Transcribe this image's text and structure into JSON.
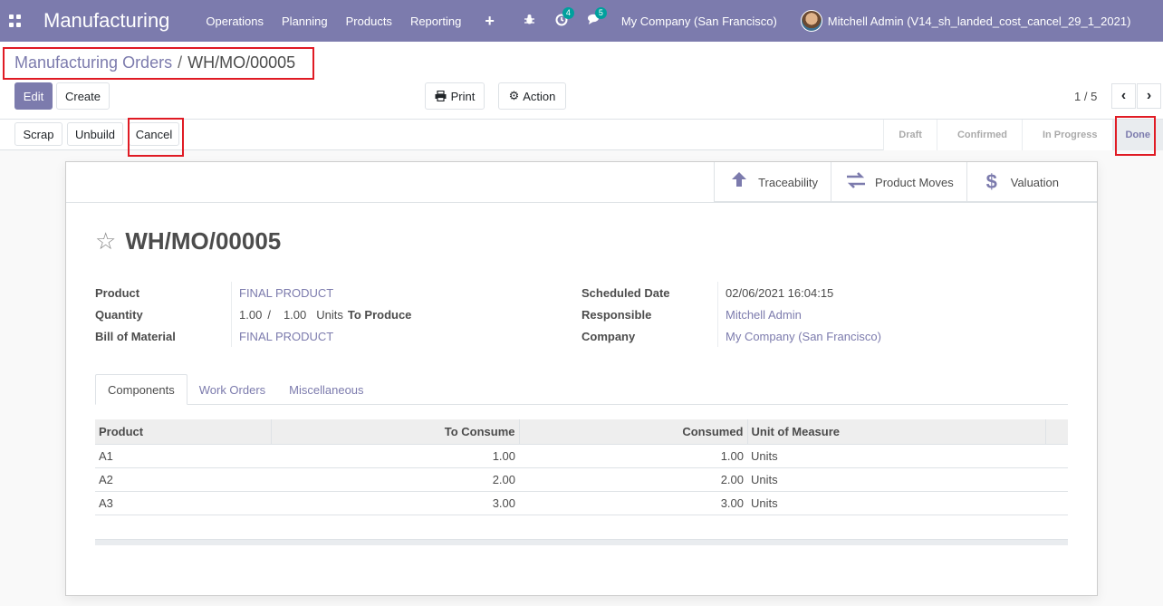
{
  "navbar": {
    "app_name": "Manufacturing",
    "menu": [
      "Operations",
      "Planning",
      "Products",
      "Reporting"
    ],
    "activity_count": "4",
    "messages_count": "5",
    "company": "My Company (San Francisco)",
    "user": "Mitchell Admin (V14_sh_landed_cost_cancel_29_1_2021)"
  },
  "breadcrumb": {
    "parent": "Manufacturing Orders",
    "separator": "/",
    "current": "WH/MO/00005"
  },
  "buttons": {
    "edit": "Edit",
    "create": "Create",
    "print": "Print",
    "action": "Action",
    "scrap": "Scrap",
    "unbuild": "Unbuild",
    "cancel": "Cancel"
  },
  "pager": {
    "value": "1 / 5"
  },
  "status_steps": [
    {
      "label": "Draft",
      "active": false
    },
    {
      "label": "Confirmed",
      "active": false
    },
    {
      "label": "In Progress",
      "active": false
    },
    {
      "label": "Done",
      "active": true
    }
  ],
  "smart_buttons": [
    {
      "label": "Traceability",
      "icon": "arrow-up-icon"
    },
    {
      "label": "Product Moves",
      "icon": "exchange-icon"
    },
    {
      "label": "Valuation",
      "icon": "dollar-icon"
    }
  ],
  "record": {
    "title": "WH/MO/00005",
    "product_label": "Product",
    "product": "FINAL PRODUCT",
    "quantity_label": "Quantity",
    "qty_produced": "1.00",
    "qty_sep": "/",
    "qty_total": "1.00",
    "uom": "Units",
    "to_produce": "To Produce",
    "bom_label": "Bill of Material",
    "bom": "FINAL PRODUCT",
    "scheduled_label": "Scheduled Date",
    "scheduled": "02/06/2021 16:04:15",
    "responsible_label": "Responsible",
    "responsible": "Mitchell Admin",
    "company_label": "Company",
    "company": "My Company (San Francisco)"
  },
  "tabs": [
    "Components",
    "Work Orders",
    "Miscellaneous"
  ],
  "components": {
    "columns": [
      "Product",
      "To Consume",
      "Consumed",
      "Unit of Measure"
    ],
    "rows": [
      {
        "product": "A1",
        "to_consume": "1.00",
        "consumed": "1.00",
        "uom": "Units"
      },
      {
        "product": "A2",
        "to_consume": "2.00",
        "consumed": "2.00",
        "uom": "Units"
      },
      {
        "product": "A3",
        "to_consume": "3.00",
        "consumed": "3.00",
        "uom": "Units"
      }
    ]
  },
  "colors": {
    "brand": "#7c7bad",
    "highlight_box": "#e01b24"
  }
}
